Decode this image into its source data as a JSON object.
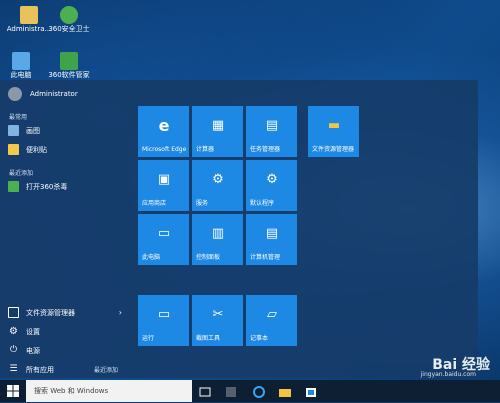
{
  "desktop_icons": [
    {
      "label": "Administra..."
    },
    {
      "label": "360安全卫士"
    },
    {
      "label": "此电脑"
    },
    {
      "label": "360软件管家"
    }
  ],
  "start_menu": {
    "user": "Administrator",
    "most_used_label": "最常用",
    "most_used": [
      {
        "label": "画图"
      },
      {
        "label": "便利贴"
      }
    ],
    "recent_label": "最近添加",
    "recent": [
      {
        "label": "打开360杀毒"
      }
    ],
    "bottom": [
      {
        "label": "文件资源管理器"
      },
      {
        "label": "设置"
      },
      {
        "label": "电源"
      },
      {
        "label": "所有应用"
      }
    ],
    "recently_added_link": "最近添加",
    "tiles_group1": [
      {
        "label": "Microsoft Edge",
        "glyph": "e"
      },
      {
        "label": "计算器",
        "glyph": "▦"
      },
      {
        "label": "任务管理器",
        "glyph": "▤"
      },
      {
        "label": "应用商店",
        "glyph": "▣"
      },
      {
        "label": "服务",
        "glyph": "⚙"
      },
      {
        "label": "默认程序",
        "glyph": "⚙"
      },
      {
        "label": "此电脑",
        "glyph": "▭"
      },
      {
        "label": "控制面板",
        "glyph": "▥"
      },
      {
        "label": "计算机管理",
        "glyph": "▤"
      }
    ],
    "tile_file_explorer": {
      "label": "文件资源管理器",
      "glyph": "▬"
    },
    "tiles_group2": [
      {
        "label": "运行",
        "glyph": "▭"
      },
      {
        "label": "截图工具",
        "glyph": "✂"
      },
      {
        "label": "记事本",
        "glyph": "▱"
      }
    ]
  },
  "taskbar": {
    "search_placeholder": "搜索 Web 和 Windows"
  },
  "watermark": {
    "brand": "Bai 经验",
    "url": "jingyan.baidu.com"
  },
  "colors": {
    "tile_blue": "#1e88e5",
    "menu_bg": "#163c69",
    "taskbar_bg": "#0e1f33"
  }
}
